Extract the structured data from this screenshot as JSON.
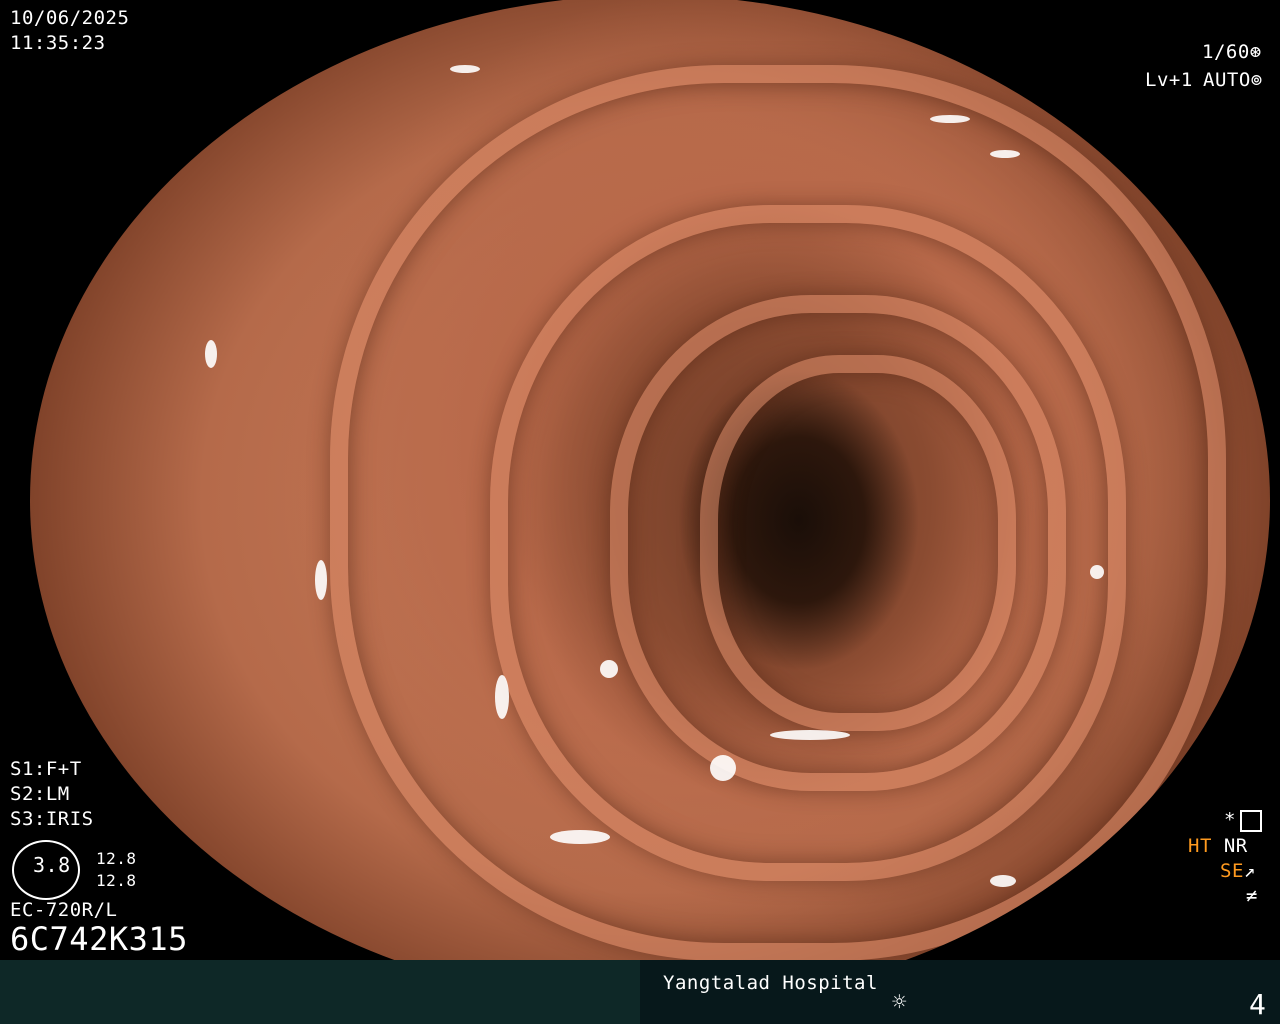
{
  "date": "10/06/2025",
  "time": "11:35:23",
  "shutter": "1/60",
  "level": "Lv+1",
  "iris_mode": "AUTO",
  "settings": [
    "S1:F+T",
    "S2:LM",
    "S3:IRIS"
  ],
  "zoom": {
    "value": "3.8",
    "top": "12.8",
    "bottom": "12.8"
  },
  "scope_model": "EC-720R/L",
  "serial": "6C742K315",
  "right_indicators": {
    "asterisk": "*",
    "ht": "HT",
    "nr": "NR",
    "se": "SE",
    "not_equal": "≠"
  },
  "hospital": "Yangtalad Hospital",
  "page_number": "4",
  "colors": {
    "accent_orange": "#ff9a1f",
    "bar_left": "#0e2827",
    "bar_right": "#07181b"
  },
  "icons": [
    "shutter-icon",
    "iris-icon",
    "settings-icon",
    "light-icon"
  ]
}
